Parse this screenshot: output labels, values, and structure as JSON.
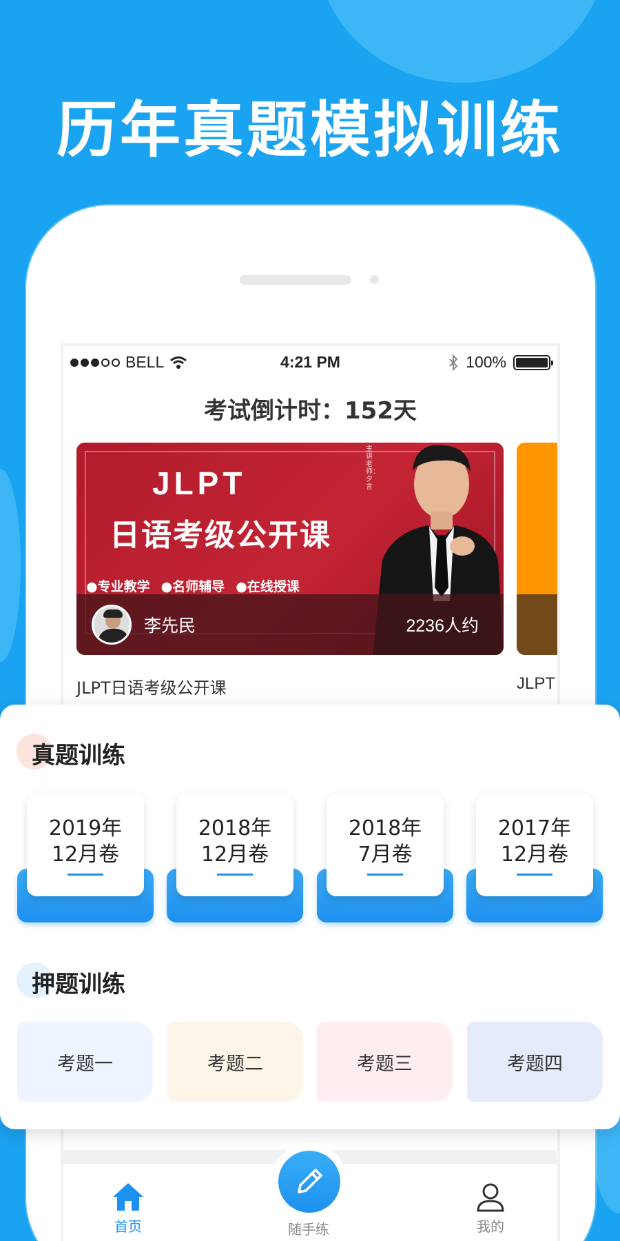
{
  "headline": "历年真题模拟训练",
  "status_bar": {
    "carrier": "BELL",
    "time": "4:21 PM",
    "battery": "100%",
    "battery_level": 1.0
  },
  "countdown": "考试倒计时：152天",
  "banner": {
    "title_line1": "JLPT",
    "title_line2": "日语考级公开课",
    "tags": [
      "●专业教学",
      "●名师辅导",
      "●在线授课"
    ],
    "vertical_text": "主讲老师：夕言",
    "teacher": "李先民",
    "count": "2236人约",
    "course_title": "JLPT日语考级公开课",
    "next_course_title": "JLPT"
  },
  "real_section": {
    "title": "真题训练",
    "papers": [
      {
        "year": "2019年",
        "month": "12月卷"
      },
      {
        "year": "2018年",
        "month": "12月卷"
      },
      {
        "year": "2018年",
        "month": "7月卷"
      },
      {
        "year": "2017年",
        "month": "12月卷"
      }
    ]
  },
  "predict_section": {
    "title": "押题训练",
    "topics": [
      {
        "label": "考题一",
        "color": "#eef5ff"
      },
      {
        "label": "考题二",
        "color": "#fcf4e6"
      },
      {
        "label": "考题三",
        "color": "#ffeef0"
      },
      {
        "label": "考题四",
        "color": "#e6ebfb"
      }
    ]
  },
  "tabbar": {
    "home": "首页",
    "practice": "随手练",
    "mine": "我的"
  },
  "colors": {
    "background": "#1aa3f0",
    "accent": "#1e90ef"
  },
  "icons": [
    "wifi-icon",
    "bluetooth-icon",
    "battery-icon",
    "home-icon",
    "pencil-icon",
    "user-icon"
  ]
}
